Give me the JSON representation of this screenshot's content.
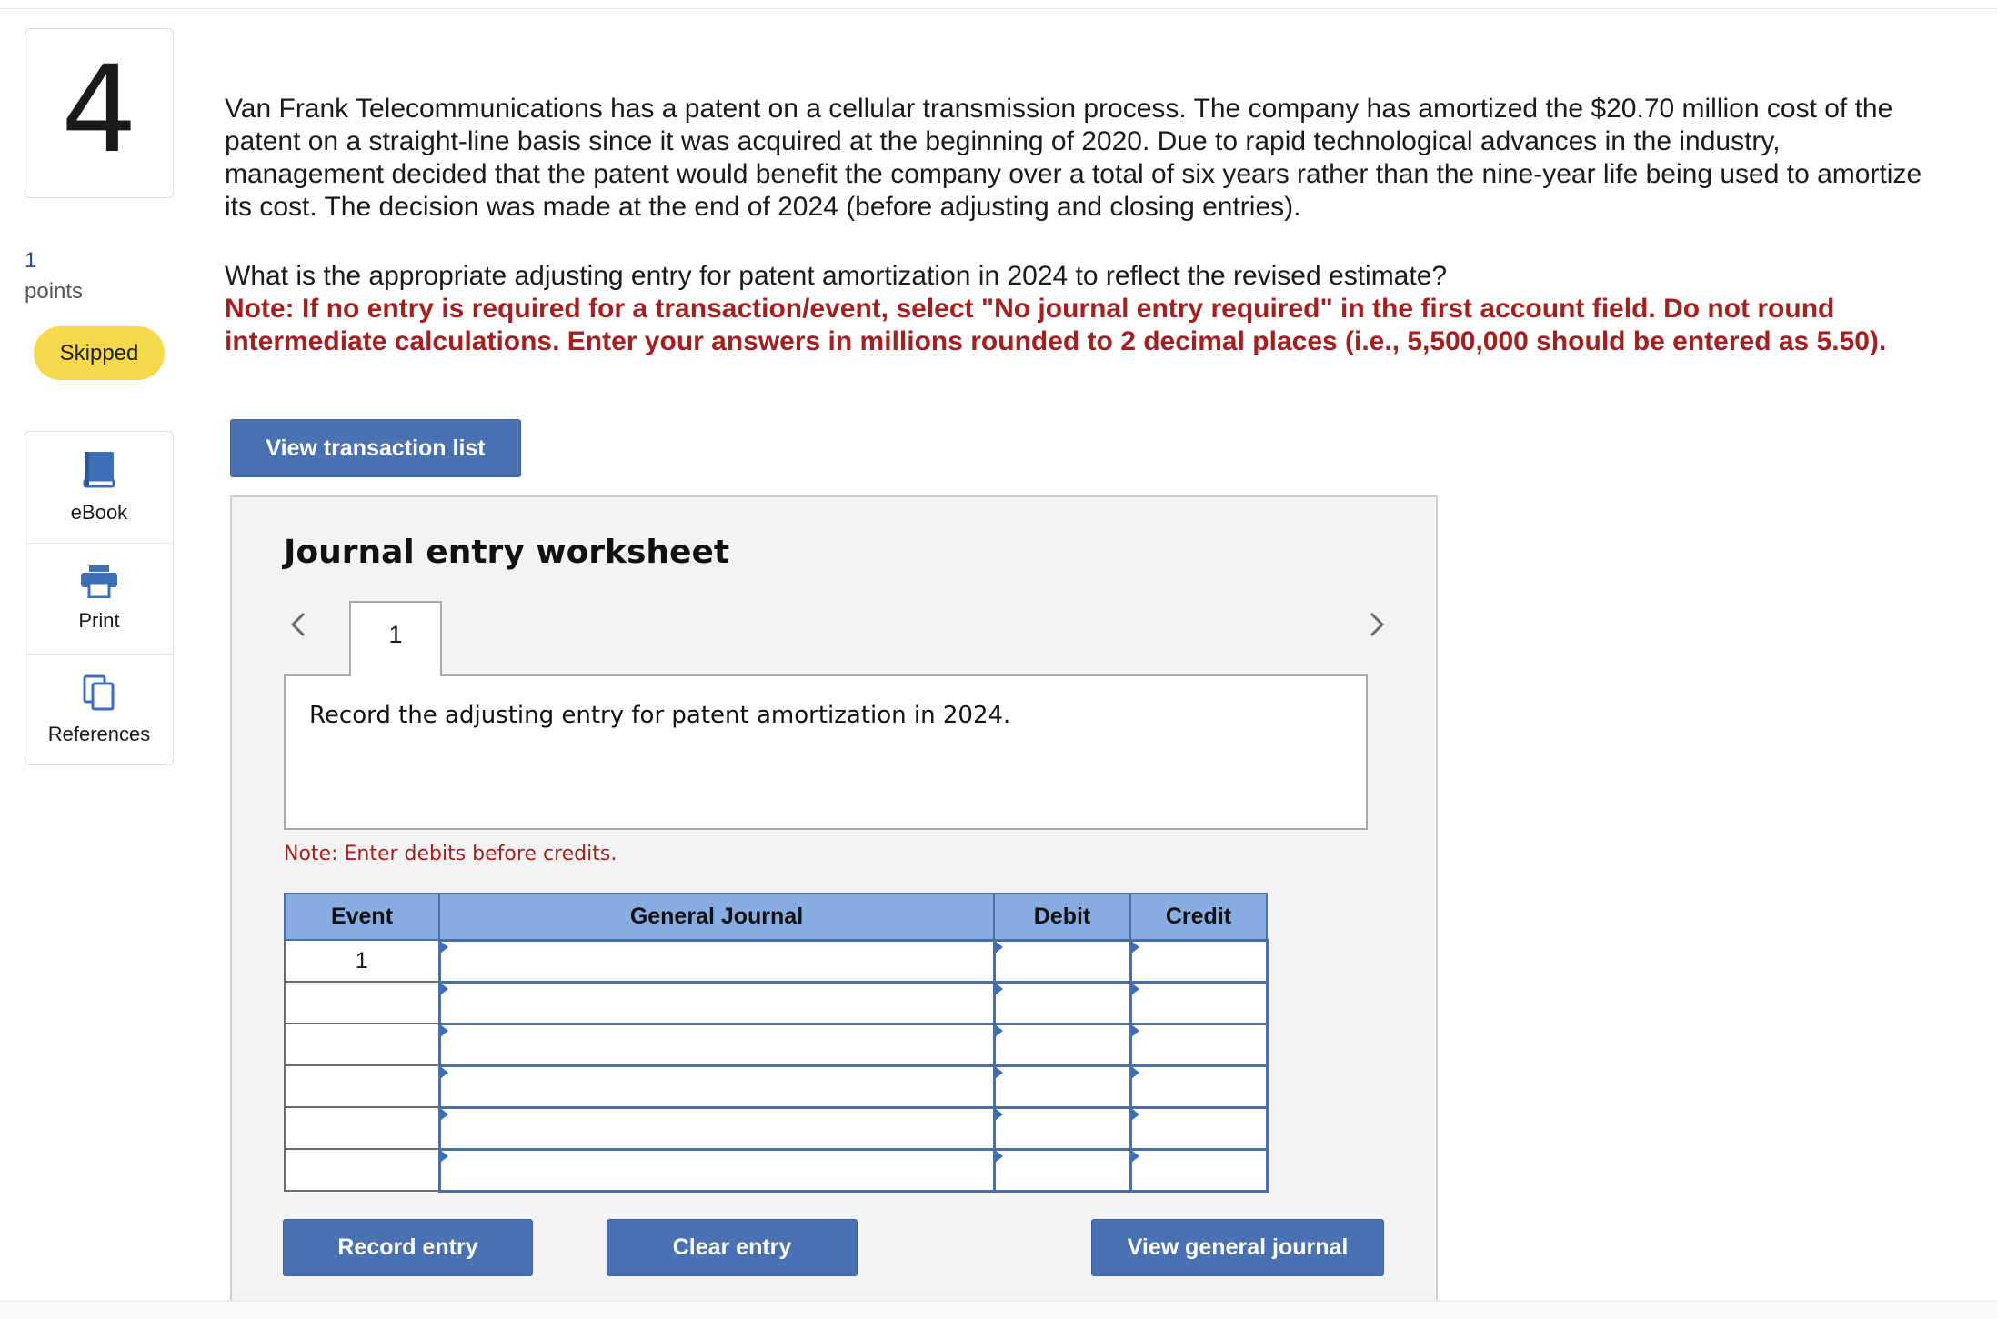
{
  "question": {
    "number": "4",
    "points_value": "1",
    "points_label": "points",
    "status_badge": "Skipped",
    "text": "Van Frank Telecommunications has a patent on a cellular transmission process. The company has amortized the $20.70 million cost of the patent on a straight-line basis since it was acquired at the beginning of 2020. Due to rapid technological advances in the industry, management decided that the patent would benefit the company over a total of six years rather than the nine-year life being used to amortize its cost. The decision was made at the end of 2024 (before adjusting and closing entries).",
    "prompt": "What is the appropriate adjusting entry for patent amortization in 2024 to reflect the revised estimate?",
    "note": "Note: If no entry is required for a transaction/event, select \"No journal entry required\" in the first account field. Do not round intermediate calculations. Enter your answers in millions rounded to 2 decimal places (i.e., 5,500,000 should be entered as 5.50)."
  },
  "tools": [
    {
      "label": "eBook",
      "icon": "book-icon"
    },
    {
      "label": "Print",
      "icon": "printer-icon"
    },
    {
      "label": "References",
      "icon": "copy-icon"
    }
  ],
  "buttons": {
    "view_transaction_list": "View transaction list",
    "record_entry": "Record entry",
    "clear_entry": "Clear entry",
    "view_general_journal": "View general journal"
  },
  "worksheet": {
    "title": "Journal entry worksheet",
    "tabs": [
      "1"
    ],
    "instruction": "Record the adjusting entry for patent amortization in 2024.",
    "debit_note": "Note: Enter debits before credits.",
    "columns": [
      "Event",
      "General Journal",
      "Debit",
      "Credit"
    ],
    "rows": [
      {
        "event": "1",
        "account": "",
        "debit": "",
        "credit": ""
      },
      {
        "event": "",
        "account": "",
        "debit": "",
        "credit": ""
      },
      {
        "event": "",
        "account": "",
        "debit": "",
        "credit": ""
      },
      {
        "event": "",
        "account": "",
        "debit": "",
        "credit": ""
      },
      {
        "event": "",
        "account": "",
        "debit": "",
        "credit": ""
      },
      {
        "event": "",
        "account": "",
        "debit": "",
        "credit": ""
      }
    ]
  },
  "colors": {
    "accent_button": "#4a72b2",
    "table_header": "#86ace1",
    "note_red": "#a41f1f",
    "skipped_badge": "#f5d94a",
    "points_blue": "#1f4e99"
  }
}
